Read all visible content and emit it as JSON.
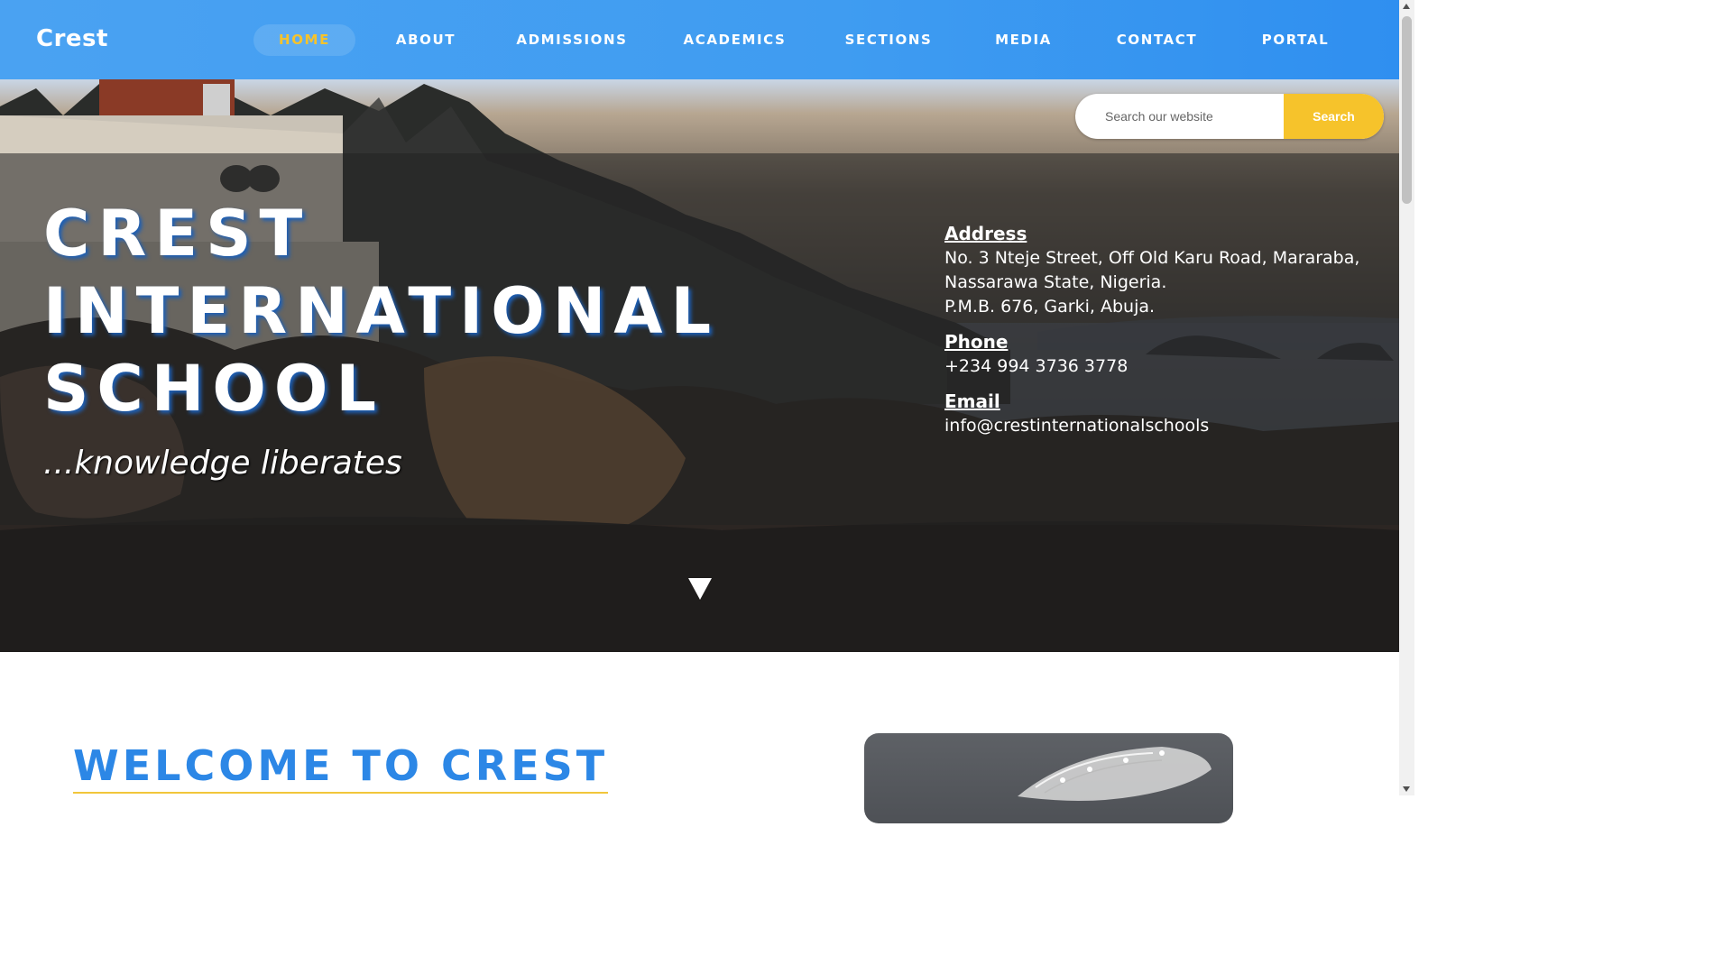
{
  "nav": {
    "brand": "Crest",
    "items": [
      {
        "label": "HOME",
        "active": true
      },
      {
        "label": "ABOUT",
        "active": false
      },
      {
        "label": "ADMISSIONS",
        "active": false
      },
      {
        "label": "ACADEMICS",
        "active": false
      },
      {
        "label": "SECTIONS",
        "active": false
      },
      {
        "label": "MEDIA",
        "active": false
      },
      {
        "label": "CONTACT",
        "active": false
      },
      {
        "label": "PORTAL",
        "active": false
      }
    ]
  },
  "search": {
    "placeholder": "Search our website",
    "button_label": "Search"
  },
  "hero": {
    "title_lines": [
      "CREST",
      "INTERNATIONAL",
      "SCHOOL"
    ],
    "tagline": "...knowledge liberates",
    "scroll_icon": "triangle-down-icon"
  },
  "contact": {
    "address_label": "Address",
    "address_lines": [
      "No. 3 Nteje Street, Off Old Karu Road, Mararaba,",
      "Nassarawa State, Nigeria.",
      "P.M.B. 676, Garki, Abuja."
    ],
    "phone_label": "Phone",
    "phone": "+234 994 3736 3778",
    "email_label": "Email",
    "email": "info@crestinternationalschools"
  },
  "welcome": {
    "title": "WELCOME TO CREST"
  },
  "colors": {
    "nav_blue": "#3f9cf1",
    "accent_yellow": "#f6c32b",
    "heading_blue": "#2c87e6"
  }
}
